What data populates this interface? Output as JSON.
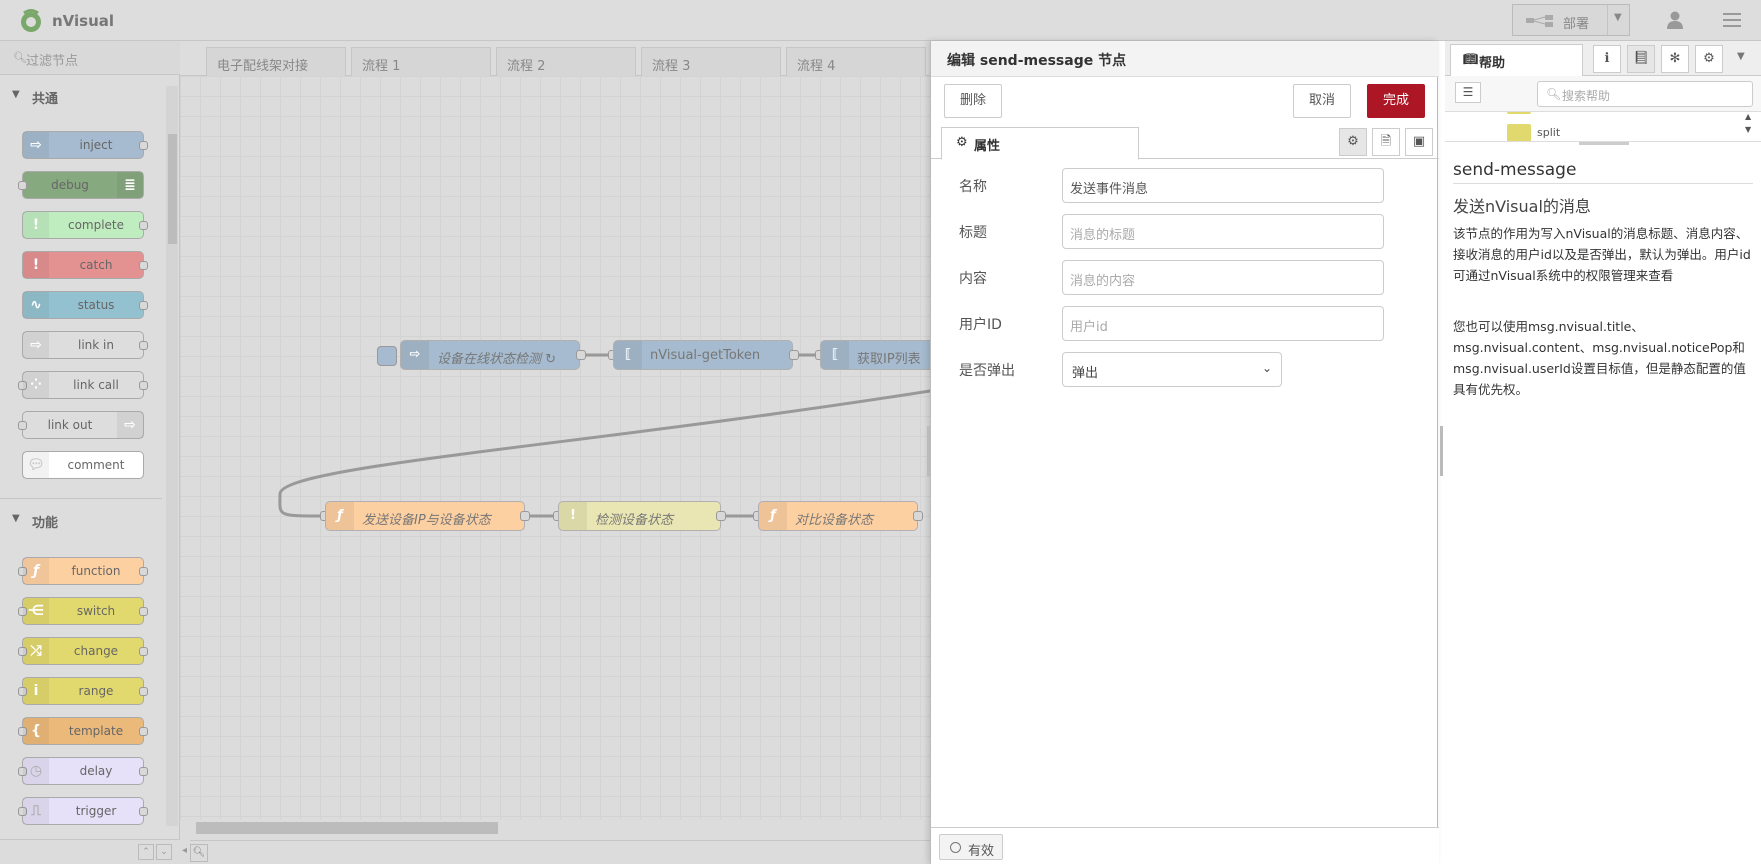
{
  "header": {
    "brand": "nVisual",
    "deploy_label": "部署"
  },
  "palette": {
    "search_placeholder": "过滤节点",
    "categories": [
      {
        "name": "共通"
      },
      {
        "name": "功能"
      }
    ],
    "common_nodes": [
      "inject",
      "debug",
      "complete",
      "catch",
      "status",
      "link in",
      "link call",
      "link out",
      "comment"
    ],
    "function_nodes": [
      "function",
      "switch",
      "change",
      "range",
      "template",
      "delay",
      "trigger"
    ],
    "colors": {
      "inject": "#a6bbcf",
      "debug": "#87a980",
      "complete": "#c0edc0",
      "catch": "#e49191",
      "status": "#94c1d0",
      "link": "#dddddd",
      "function": "#fdd0a2",
      "switch": "#e2d96e",
      "change": "#e2d96e",
      "range": "#e2d96e",
      "template": "#ebb97a",
      "delay": "#e6e0f8",
      "trigger": "#e6e0f8"
    }
  },
  "workspace": {
    "tabs": [
      "电子配线架对接",
      "流程 1",
      "流程 2",
      "流程 3",
      "流程 4"
    ],
    "flow_nodes": [
      "设备在线状态检测 ↻",
      "nVisual-getToken",
      "获取IP列表",
      "发送设备IP与设备状态",
      "检测设备状态",
      "对比设备状态"
    ]
  },
  "tray": {
    "title": "编辑 send-message 节点",
    "delete_label": "删除",
    "cancel_label": "取消",
    "done_label": "完成",
    "props_tab": "属性",
    "fields": {
      "name_label": "名称",
      "name_value": "发送事件消息",
      "title_label": "标题",
      "title_placeholder": "消息的标题",
      "content_label": "内容",
      "content_placeholder": "消息的内容",
      "userid_label": "用户ID",
      "userid_placeholder": "用户id",
      "popup_label": "是否弹出",
      "popup_value": "弹出"
    },
    "enabled_label": "有效"
  },
  "sidebar": {
    "help_tab": "帮助",
    "search_placeholder": "搜索帮助",
    "tree_visible_item": "split",
    "help_heading": "send-message",
    "help_subheading": "发送nVisual的消息",
    "help_p1": "该节点的作用为写入nVisual的消息标题、消息内容、接收消息的用户id以及是否弹出，默认为弹出。用户id可通过nVisual系统中的权限管理来查看",
    "help_p2": "您也可以使用msg.nvisual.title、msg.nvisual.content、msg.nvisual.noticePop和msg.nvisual.userId设置目标值，但是静态配置的值具有优先权。"
  },
  "accent_color": "#ad1625"
}
